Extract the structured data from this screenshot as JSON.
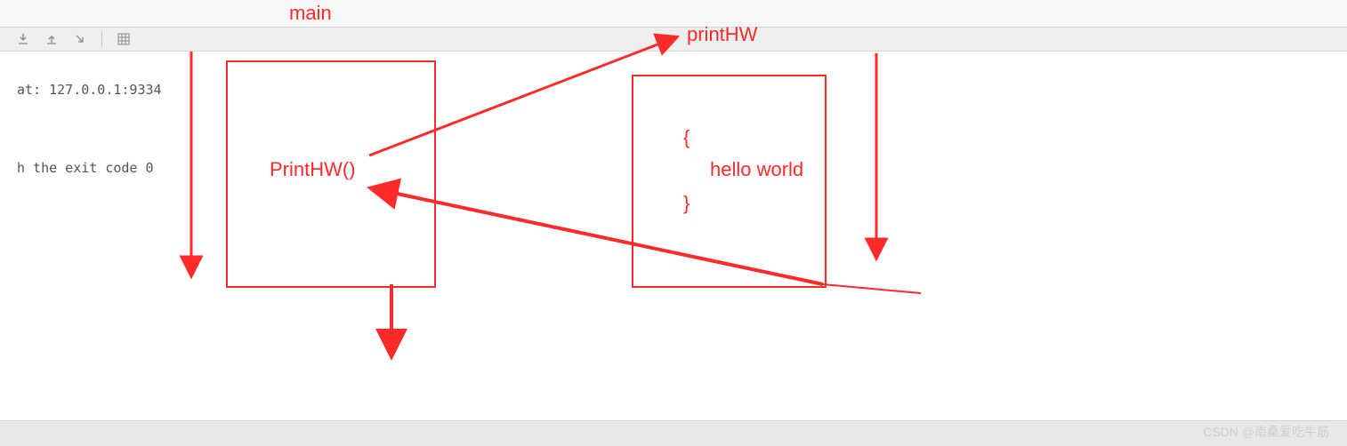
{
  "annotations": {
    "main_label": "main",
    "printhw_label": "printHW",
    "box1_text": "PrintHW()",
    "box2_brace_open": "{",
    "box2_body": "hello world",
    "box2_brace_close": "}"
  },
  "console": {
    "line1": "at: 127.0.0.1:9334",
    "line2": "h the exit code 0"
  },
  "watermark": "CSDN @南桑爱吃牛筋",
  "colors": {
    "annotation": "#ff2a2a",
    "toolbar_bg": "#efefef",
    "console_bg": "#ffffff"
  }
}
